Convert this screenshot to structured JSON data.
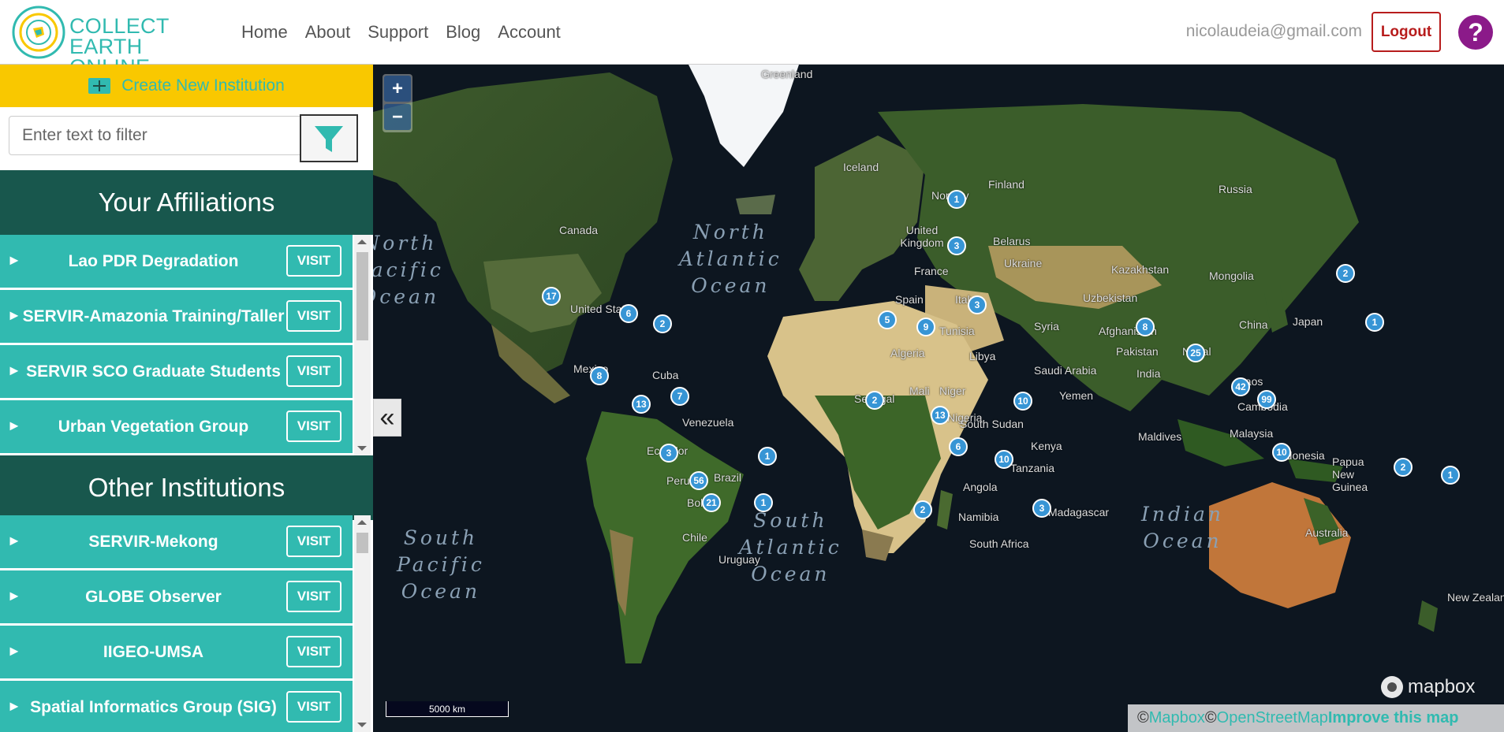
{
  "header": {
    "logo_line1": "COLLECT EARTH",
    "logo_line2": "ONLINE",
    "nav": [
      "Home",
      "About",
      "Support",
      "Blog",
      "Account"
    ],
    "user_email": "nicolaudeia@gmail.com",
    "logout_label": "Logout",
    "help_label": "?"
  },
  "sidebar": {
    "create_label": "Create New Institution",
    "filter_placeholder": "Enter text to filter",
    "affiliations_title": "Your Affiliations",
    "other_title": "Other Institutions",
    "visit_label": "VISIT",
    "arrow": "►",
    "affiliations": [
      "Lao PDR Degradation",
      "SERVIR-Amazonia Training/Taller",
      "SERVIR SCO Graduate Students",
      "Urban Vegetation Group"
    ],
    "others": [
      "SERVIR-Mekong",
      "GLOBE Observer",
      "IIGEO-UMSA",
      "Spatial Informatics Group (SIG)"
    ],
    "collapse_glyph": "«"
  },
  "map": {
    "zoom_in": "+",
    "zoom_out": "−",
    "scale_label": "5000 km",
    "mapbox_label": "mapbox",
    "attribution": {
      "copy1": "© ",
      "mapbox": "Mapbox",
      "copy2": "© ",
      "osm": "OpenStreetMap",
      "improve": "Improve this map"
    },
    "place_labels": [
      "Greenland",
      "Iceland",
      "Finland",
      "Russia",
      "Canada",
      "Norway",
      "United Kingdom",
      "Belarus",
      "Ukraine",
      "France",
      "Kazakhstan",
      "Mongolia",
      "Spain",
      "Italy",
      "Uzbekistan",
      "United States",
      "China",
      "Japan",
      "Tunisia",
      "Syria",
      "Afghanistan",
      "Algeria",
      "Libya",
      "Saudi Arabia",
      "Pakistan",
      "Nepal",
      "Mexico",
      "Cuba",
      "India",
      "Mali",
      "Niger",
      "Senegal",
      "Yemen",
      "Laos",
      "Cambodia",
      "Venezuela",
      "Nigeria",
      "South Sudan",
      "Maldives",
      "Malaysia",
      "Ecuador",
      "Kenya",
      "Indonesia",
      "Brazil",
      "Tanzania",
      "Papua New Guinea",
      "Peru",
      "Bolivia",
      "Angola",
      "Namibia",
      "Madagascar",
      "Chile",
      "Uruguay",
      "South Africa",
      "Australia",
      "New Zealand"
    ],
    "ocean_labels": [
      "North\nPacific\nOcean",
      "North\nAtlantic\nOcean",
      "South\nPacific\nOcean",
      "South\nAtlantic\nOcean",
      "Indian\nOcean"
    ],
    "clusters": [
      "1",
      "3",
      "2",
      "17",
      "6",
      "2",
      "5",
      "9",
      "3",
      "8",
      "1",
      "25",
      "8",
      "42",
      "99",
      "13",
      "7",
      "2",
      "13",
      "10",
      "3",
      "1",
      "6",
      "10",
      "10",
      "56",
      "21",
      "1",
      "2",
      "3",
      "2",
      "1"
    ]
  },
  "colors": {
    "brand_teal": "#31bab0",
    "section_dark": "#18574d",
    "create_bar": "#f9c800",
    "logout": "#b71c1c",
    "help": "#8b1a89",
    "cluster": "#3795d5"
  }
}
